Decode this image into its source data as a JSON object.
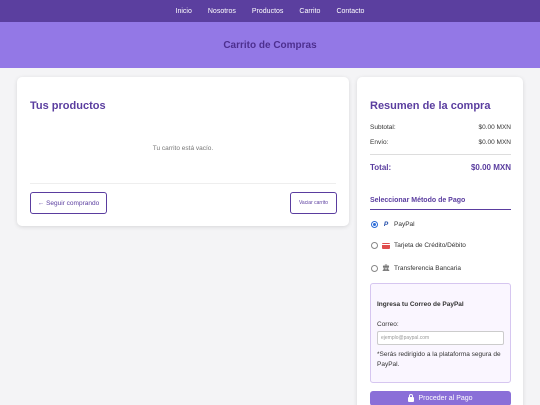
{
  "nav": {
    "items": [
      "Inicio",
      "Nosotros",
      "Productos",
      "Carrito",
      "Contacto"
    ]
  },
  "hero": {
    "title": "Carrito de Compras"
  },
  "cart": {
    "title": "Tus productos",
    "empty_message": "Tu carrito está vacío.",
    "continue_label": "← Seguir comprando",
    "clear_label": "Vaciar carrito"
  },
  "summary": {
    "title": "Resumen de la compra",
    "subtotal_label": "Subtotal:",
    "subtotal_value": "$0.00 MXN",
    "shipping_label": "Envío:",
    "shipping_value": "$0.00 MXN",
    "total_label": "Total:",
    "total_value": "$0.00 MXN"
  },
  "payment": {
    "title": "Seleccionar Método de Pago",
    "options": [
      {
        "label": "PayPal",
        "icon": "paypal-icon",
        "selected": true
      },
      {
        "label": "Tarjeta de Crédito/Débito",
        "icon": "credit-card-icon",
        "selected": false
      },
      {
        "label": "Transferencia Bancaria",
        "icon": "bank-icon",
        "selected": false
      }
    ],
    "paypal_box": {
      "title": "Ingresa tu Correo de PayPal",
      "email_label": "Correo:",
      "email_placeholder": "ejemplo@paypal.com",
      "email_value": "",
      "note": "*Serás redirigido a la plataforma segura de PayPal."
    },
    "proceed_label": "Proceder al Pago"
  },
  "colors": {
    "nav_bg": "#5b3f9f",
    "hero_bg": "#9378e6",
    "accent": "#5a3d9f",
    "pay_button": "#8a6fd8"
  }
}
